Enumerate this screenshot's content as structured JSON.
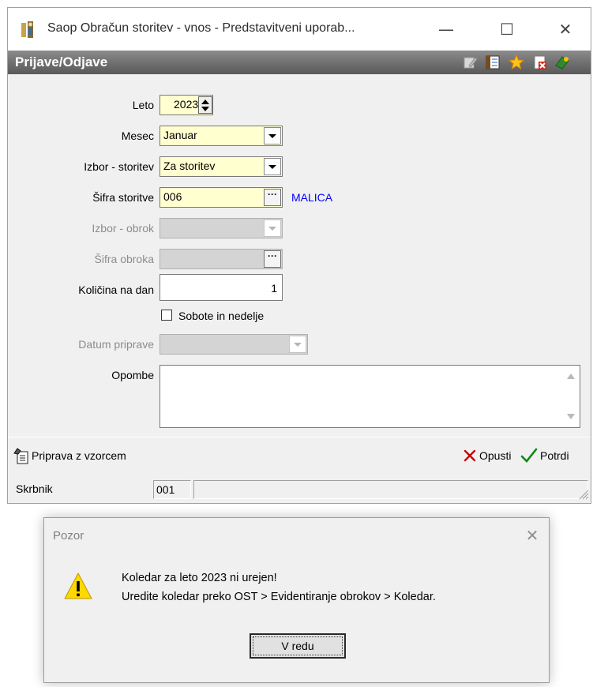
{
  "window": {
    "title": "Saop Obračun storitev - vnos - Predstavitveni uporab...",
    "minimize_glyph": "—",
    "maximize_glyph": "☐",
    "close_glyph": "✕"
  },
  "header": {
    "title": "Prijave/Odjave",
    "icons": [
      "edit-icon",
      "columns-icon",
      "favorite-star-icon",
      "close-form-icon",
      "help-icon"
    ]
  },
  "form": {
    "leto": {
      "label": "Leto",
      "value": "2023"
    },
    "mesec": {
      "label": "Mesec",
      "value": "Januar"
    },
    "izbor_storitev": {
      "label": "Izbor - storitev",
      "value": "Za storitev"
    },
    "sifra_storitve": {
      "label": "Šifra storitve",
      "value": "006",
      "description": "MALICA"
    },
    "izbor_obrok": {
      "label": "Izbor - obrok",
      "value": ""
    },
    "sifra_obroka": {
      "label": "Šifra obroka",
      "value": ""
    },
    "kolicina": {
      "label": "Količina na dan",
      "value": "1"
    },
    "sobote": {
      "label": "Sobote in nedelje",
      "checked": false
    },
    "datum_priprave": {
      "label": "Datum priprave",
      "value": ""
    },
    "opombe": {
      "label": "Opombe",
      "value": ""
    },
    "lookup_glyph": "···"
  },
  "footer": {
    "template_button": "Priprava z vzorcem",
    "cancel_button": "Opusti",
    "confirm_button": "Potrdi"
  },
  "statusbar": {
    "label": "Skrbnik",
    "code": "001",
    "extra": ""
  },
  "dialog": {
    "title": "Pozor",
    "close_glyph": "✕",
    "message_line1": "Koledar za leto 2023 ni urejen!",
    "message_line2": "Uredite koledar preko OST > Evidentiranje obrokov > Koledar.",
    "ok_button": "V redu"
  },
  "colors": {
    "field_bg": "#ffffd0",
    "header_bar": "#6e6e6e",
    "link_blue": "#0000ff",
    "cancel_red": "#cc0000",
    "confirm_green": "#118811",
    "warning_yellow": "#ffd800"
  }
}
